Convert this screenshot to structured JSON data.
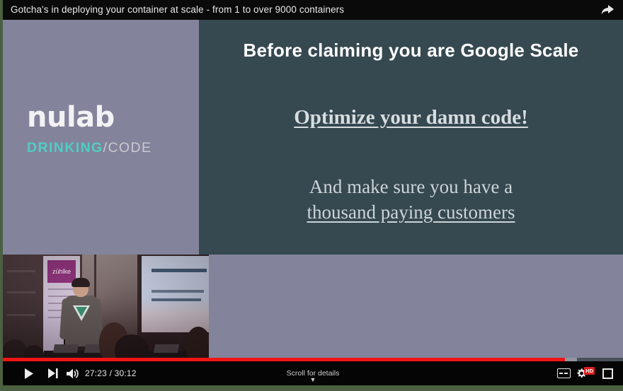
{
  "page": {
    "background_color": "#4a6040",
    "player_background": "#000000"
  },
  "titlebar": {
    "title": "Gotcha's in deploying your container at scale - from 1 to over 9000 containers",
    "share_icon": "share-arrow-icon"
  },
  "slide": {
    "left_panel_color": "#83849b",
    "right_panel_color": "#364850",
    "logo": {
      "wordmark": "nulab",
      "tagline_primary": "DRINKING",
      "tagline_separator": "/",
      "tagline_secondary": "CODE",
      "primary_color": "#4fcdc5",
      "secondary_color": "#c9cad3",
      "wordmark_color": "#f2f2f4"
    },
    "title": "Before claiming you are Google Scale",
    "headline": "Optimize your damn code!",
    "body_line_1": "And make sure you have a",
    "body_line_2": "thousand paying customers"
  },
  "pip": {
    "label": "speaker-camera-feed",
    "banner_brand": "zühlke"
  },
  "progress": {
    "played_percent": 90.5,
    "buffered_percent": 92.6,
    "played_color": "#f01414",
    "buffered_color": "#9094a0",
    "track_color": "#4b4f5a"
  },
  "controls": {
    "play_icon": "play-icon",
    "next_icon": "next-track-icon",
    "volume_icon": "volume-on-icon",
    "current_time": "27:23",
    "duration": "30:12",
    "time_separator": " / ",
    "time_display": "27:23 / 30:12",
    "scroll_hint": "Scroll for details",
    "scroll_chevron": "▼",
    "cc_icon": "closed-captions-icon",
    "quality_icon": "settings-gear-icon",
    "quality_badge": "HD",
    "size_icon": "exit-fullscreen-icon"
  }
}
